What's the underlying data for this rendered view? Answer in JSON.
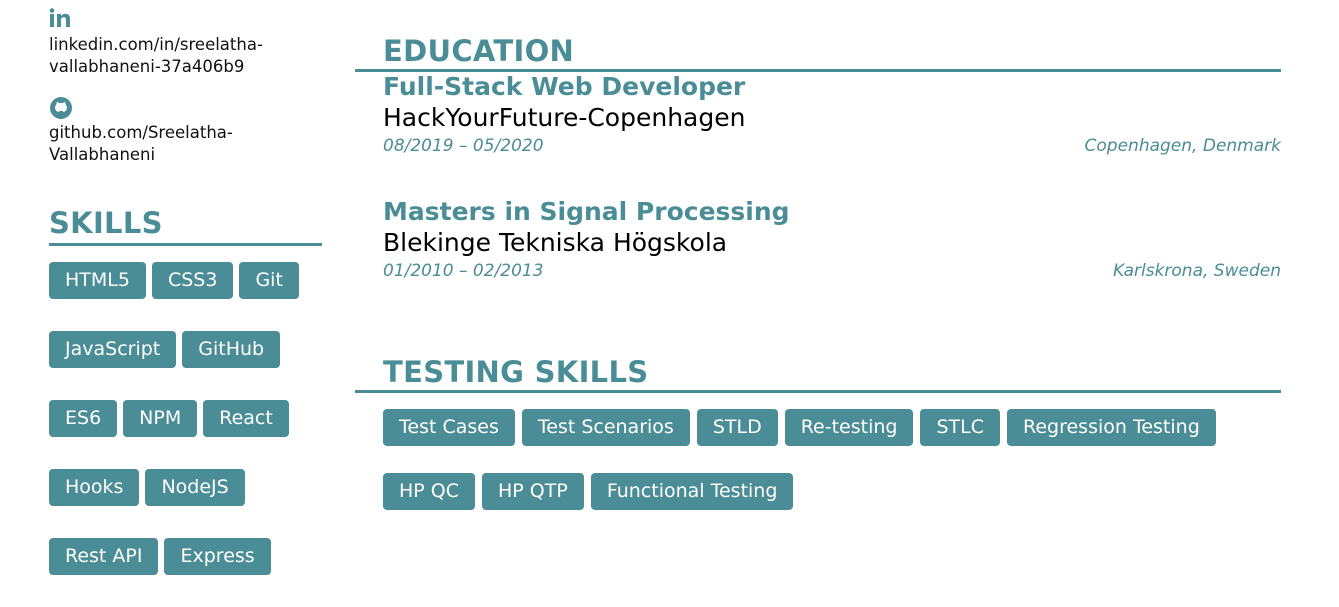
{
  "contact": {
    "linkedin": {
      "icon": "linkedin-icon",
      "line1": "linkedin.com/in/sreelatha-",
      "line2": "vallabhaneni-37a406b9"
    },
    "github": {
      "icon": "github-icon",
      "line1": "github.com/Sreelatha-",
      "line2": "Vallabhaneni"
    }
  },
  "skills": {
    "title": "SKILLS",
    "rows": [
      [
        "HTML5",
        "CSS3",
        "Git"
      ],
      [
        "JavaScript",
        "GitHub"
      ],
      [
        "ES6",
        "NPM",
        "React"
      ],
      [
        "Hooks",
        "NodeJS"
      ],
      [
        "Rest API",
        "Express"
      ]
    ]
  },
  "education": {
    "title": "EDUCATION",
    "items": [
      {
        "degree": "Full-Stack Web Developer",
        "school": "HackYourFuture-Copenhagen",
        "dates": "08/2019 – 05/2020",
        "location": "Copenhagen, Denmark"
      },
      {
        "degree": "Masters in Signal Processing",
        "school": "Blekinge Tekniska Högskola",
        "dates": "01/2010 – 02/2013",
        "location": "Karlskrona, Sweden"
      }
    ]
  },
  "testing": {
    "title": "TESTING SKILLS",
    "rows": [
      [
        "Test Cases",
        "Test Scenarios",
        "STLD",
        "Re-testing",
        "STLC",
        "Regression Testing"
      ],
      [
        "HP QC",
        "HP QTP",
        "Functional Testing"
      ]
    ]
  },
  "colors": {
    "accent": "#4a8d96",
    "text": "#000000",
    "background": "#ffffff"
  }
}
